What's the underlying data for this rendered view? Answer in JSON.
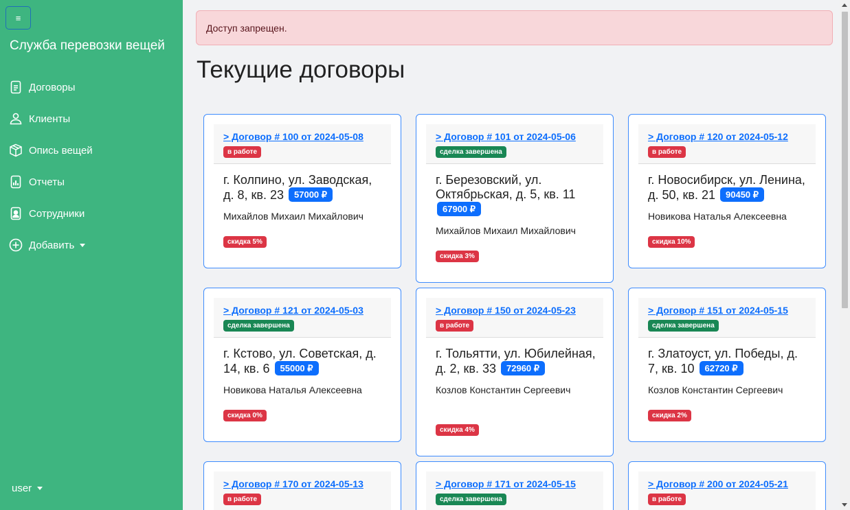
{
  "sidebar": {
    "toggle_icon": "≡",
    "brand": "Служба перевозки вещей",
    "items": [
      {
        "label": "Договоры",
        "icon": "file-text-icon"
      },
      {
        "label": "Клиенты",
        "icon": "person-icon"
      },
      {
        "label": "Опись вещей",
        "icon": "box-icon"
      },
      {
        "label": "Отчеты",
        "icon": "bar-chart-file-icon"
      },
      {
        "label": "Сотрудники",
        "icon": "person-badge-icon"
      },
      {
        "label": "Добавить",
        "icon": "plus-circle-icon"
      }
    ],
    "user": "user"
  },
  "main": {
    "alert": "Доступ запрещен.",
    "title": "Текущие договоры",
    "contracts": [
      {
        "link": "> Договор # 100 от 2024-05-08",
        "status": "в работе",
        "status_color": "#dc3545",
        "address": "г. Колпино, ул. Заводская, д. 8, кв. 23",
        "price": "57000 ₽",
        "client": "Михайлов Михаил Михайлович",
        "discount": "скидка 5%"
      },
      {
        "link": "> Договор # 101 от 2024-05-06",
        "status": "сделка завершена",
        "status_color": "#198754",
        "address": "г. Березовский, ул. Октябрьская, д. 5, кв. 11",
        "price": "67900 ₽",
        "client": "Михайлов Михаил Михайлович",
        "discount": "скидка 3%"
      },
      {
        "link": "> Договор # 120 от 2024-05-12",
        "status": "в работе",
        "status_color": "#dc3545",
        "address": "г. Новосибирск, ул. Ленина, д. 50, кв. 21",
        "price": "90450 ₽",
        "client": "Новикова Наталья Алексеевна",
        "discount": "скидка 10%"
      },
      {
        "link": "> Договор # 121 от 2024-05-03",
        "status": "сделка завершена",
        "status_color": "#198754",
        "address": "г. Кстово, ул. Советская, д. 14, кв. 6",
        "price": "55000 ₽",
        "client": "Новикова Наталья Алексеевна",
        "discount": "скидка 0%"
      },
      {
        "link": "> Договор # 150 от 2024-05-23",
        "status": "в работе",
        "status_color": "#dc3545",
        "address": "г. Тольятти, ул. Юбилейная, д. 2, кв. 33",
        "price": "72960 ₽",
        "client": "Козлов Константин Сергеевич",
        "discount": "скидка 4%"
      },
      {
        "link": "> Договор # 151 от 2024-05-15",
        "status": "сделка завершена",
        "status_color": "#198754",
        "address": "г. Златоуст, ул. Победы, д. 7, кв. 10",
        "price": "62720 ₽",
        "client": "Козлов Константин Сергеевич",
        "discount": "скидка 2%"
      },
      {
        "link": "> Договор # 170 от 2024-05-13",
        "status": "в работе",
        "status_color": "#dc3545"
      },
      {
        "link": "> Договор # 171 от 2024-05-15",
        "status": "сделка завершена",
        "status_color": "#198754"
      },
      {
        "link": "> Договор # 200 от 2024-05-21",
        "status": "в работе",
        "status_color": "#dc3545"
      }
    ]
  },
  "colors": {
    "sidebar": "#3eb580",
    "primary": "#0d6efd",
    "danger": "#dc3545",
    "success": "#198754",
    "alert_bg": "#f8d7da"
  }
}
